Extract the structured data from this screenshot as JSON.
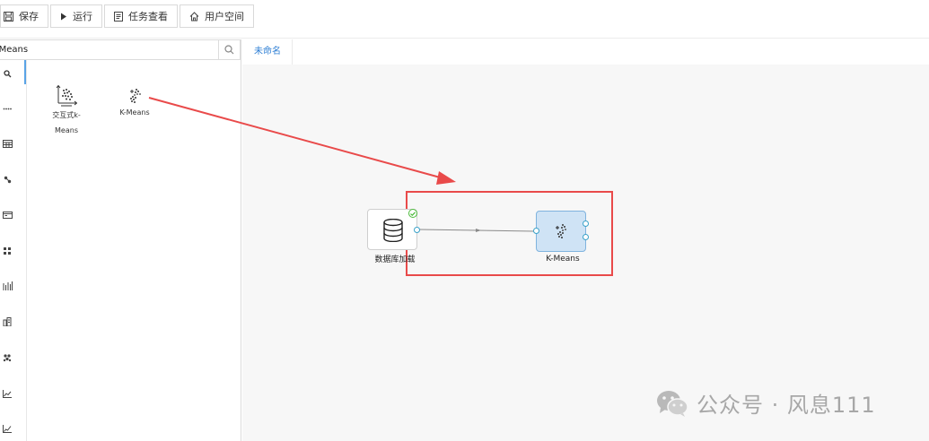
{
  "toolbar": {
    "save": "保存",
    "run": "运行",
    "tasks": "任务查看",
    "user_space": "用户空间"
  },
  "search": {
    "value": "-Means"
  },
  "tools": [
    {
      "label_line1": "交互式k-",
      "label_line2": "Means"
    },
    {
      "label_line1": "K-Means"
    }
  ],
  "tab": {
    "label": "未命名"
  },
  "nodes": {
    "db_load": {
      "label": "数据库加载"
    },
    "kmeans": {
      "label": "K-Means"
    }
  },
  "colors": {
    "accent": "#2f7fd4",
    "annotation_red": "#e94a4a",
    "node_selected_fill": "#cfe3f5",
    "port_stroke": "#3aa2c9",
    "status_ok": "#4cbb3b"
  },
  "watermark": {
    "text": "公众号 · 风息111"
  }
}
